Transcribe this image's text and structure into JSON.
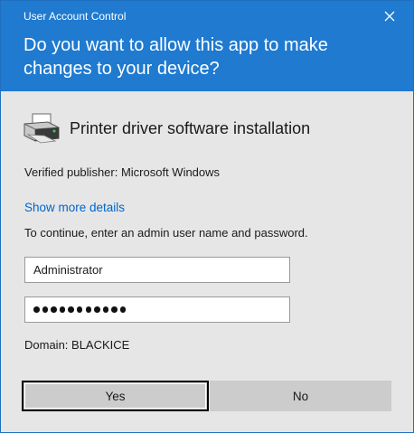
{
  "window": {
    "title": "User Account Control",
    "question": "Do you want to allow this app to make changes to your device?"
  },
  "app": {
    "icon": "printer-icon",
    "name": "Printer driver software installation",
    "publisher": "Verified publisher: Microsoft Windows"
  },
  "details_link": "Show more details",
  "instruction": "To continue, enter an admin user name and password.",
  "username": {
    "value": "Administrator"
  },
  "password": {
    "masked_length": 11
  },
  "domain": "Domain: BLACKICE",
  "buttons": {
    "yes": "Yes",
    "no": "No"
  },
  "colors": {
    "header": "#1f7ad0",
    "body": "#e6e6e6",
    "link": "#0066cc",
    "button": "#cccccc"
  }
}
